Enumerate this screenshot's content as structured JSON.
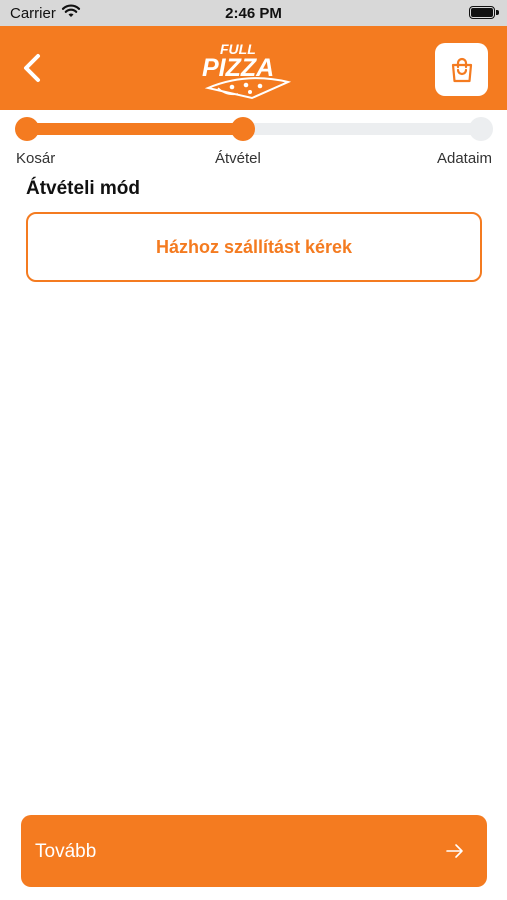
{
  "status_bar": {
    "carrier": "Carrier",
    "time": "2:46 PM"
  },
  "header": {
    "logo_top": "FULL",
    "logo_main": "PIZZA",
    "back_icon": "chevron-left-icon",
    "cart_icon": "shopping-bag-icon"
  },
  "progress": {
    "steps": [
      {
        "label": "Kosár",
        "completed": true
      },
      {
        "label": "Átvétel",
        "completed": true
      },
      {
        "label": "Adataim",
        "completed": false
      }
    ],
    "current_step": 2
  },
  "delivery": {
    "title": "Átvételi mód",
    "option_label": "Házhoz szállítást kérek"
  },
  "footer": {
    "next_label": "Tovább",
    "next_icon": "arrow-right-icon"
  },
  "colors": {
    "accent": "#f47b20",
    "track": "#eceef0"
  }
}
